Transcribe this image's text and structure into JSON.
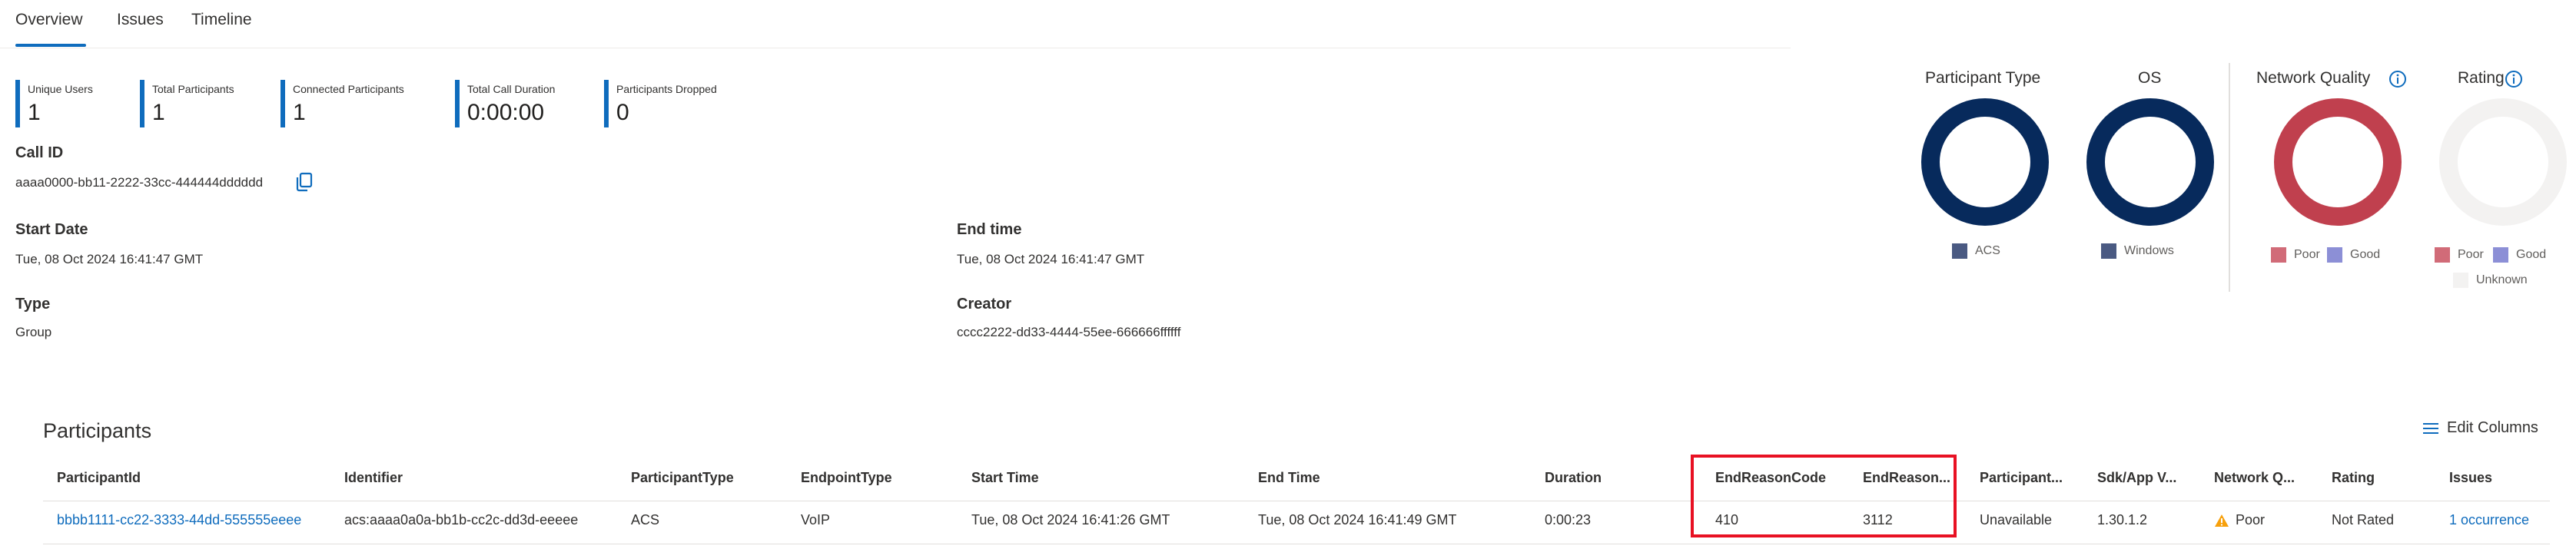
{
  "tabs": [
    {
      "label": "Overview",
      "active": true
    },
    {
      "label": "Issues",
      "active": false
    },
    {
      "label": "Timeline",
      "active": false
    }
  ],
  "stats": [
    {
      "label": "Unique Users",
      "value": "1"
    },
    {
      "label": "Total Participants",
      "value": "1"
    },
    {
      "label": "Connected Participants",
      "value": "1"
    },
    {
      "label": "Total Call Duration",
      "value": "0:00:00"
    },
    {
      "label": "Participants Dropped",
      "value": "0"
    }
  ],
  "details": {
    "call_id_label": "Call ID",
    "call_id_value": "aaaa0000-bb11-2222-33cc-444444dddddd",
    "start_date_label": "Start Date",
    "start_date_value": "Tue, 08 Oct 2024 16:41:47 GMT",
    "end_time_label": "End time",
    "end_time_value": "Tue, 08 Oct 2024 16:41:47 GMT",
    "type_label": "Type",
    "type_value": "Group",
    "creator_label": "Creator",
    "creator_value": "cccc2222-dd33-4444-55ee-666666ffffff"
  },
  "charts": {
    "participant_type": {
      "title": "Participant Type",
      "legend": [
        {
          "label": "ACS",
          "color": "#4a5a82"
        }
      ]
    },
    "os": {
      "title": "OS",
      "legend": [
        {
          "label": "Windows",
          "color": "#4a5a82"
        }
      ]
    },
    "network_quality": {
      "title": "Network Quality",
      "legend": [
        {
          "label": "Poor",
          "color": "#d16b78"
        },
        {
          "label": "Good",
          "color": "#8c8fd6"
        }
      ]
    },
    "rating": {
      "title": "Rating",
      "legend": [
        {
          "label": "Poor",
          "color": "#d16b78"
        },
        {
          "label": "Good",
          "color": "#8c8fd6"
        },
        {
          "label": "Unknown",
          "color": "#f3f2f1"
        }
      ]
    },
    "colors": {
      "navy": "#072a5c",
      "red": "#c0404e",
      "gray": "#f3f2f1"
    }
  },
  "participants": {
    "title": "Participants",
    "edit_columns_label": "Edit Columns",
    "columns": [
      "ParticipantId",
      "Identifier",
      "ParticipantType",
      "EndpointType",
      "Start Time",
      "End Time",
      "Duration",
      "EndReasonCode",
      "EndReason...",
      "Participant...",
      "Sdk/App V...",
      "Network Q...",
      "Rating",
      "Issues"
    ],
    "rows": [
      {
        "participant_id": "bbbb1111-cc22-3333-44dd-555555eeee",
        "identifier": "acs:aaaa0a0a-bb1b-cc2c-dd3d-eeeee",
        "participant_type": "ACS",
        "endpoint_type": "VoIP",
        "start_time": "Tue, 08 Oct 2024 16:41:26 GMT",
        "end_time": "Tue, 08 Oct 2024 16:41:49 GMT",
        "duration": "0:00:23",
        "end_reason_code": "410",
        "end_reason_subcode": "3112",
        "participant_status": "Unavailable",
        "sdk_version": "1.30.1.2",
        "network_quality": "Poor",
        "rating": "Not Rated",
        "issues": "1 occurrence"
      }
    ]
  }
}
